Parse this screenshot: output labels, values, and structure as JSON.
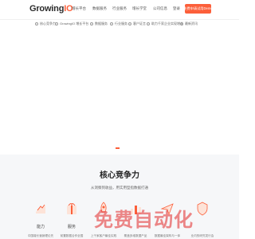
{
  "header": {
    "logo_text": "Growing",
    "logo_mark": "IO",
    "nav": [
      "增长平台",
      "数据服务",
      "行业服务",
      "增长学堂",
      "公司信息"
    ],
    "login": "登录",
    "trial_button": "免费申请试用Demo"
  },
  "subnav": {
    "items": [
      "核心竞争力",
      "GrowingIO 增长平台",
      "数据服务",
      "行业服务",
      "客户证言",
      "助力千家企业实现增长",
      "最新资讯"
    ]
  },
  "section": {
    "title": "核心竞争力",
    "subtitle": "从洞察到收益，用实用型指数据打通",
    "features": [
      {
        "label": "能力",
        "desc": "中国增长营销理论先",
        "icon": "hand-icon"
      },
      {
        "label": "服务",
        "desc": "前置数据合作全国",
        "icon": "gift-icon"
      },
      {
        "label": "",
        "desc": "上千家客户最佳实践",
        "icon": "rocket-icon"
      },
      {
        "label": "",
        "desc": "覆盖多维数据产品",
        "icon": "chart-icon"
      },
      {
        "label": "",
        "desc": "数据最佳架构与一体",
        "icon": "plane-icon"
      },
      {
        "label": "",
        "desc": "业内的研究发行会",
        "icon": "shield-icon"
      }
    ]
  },
  "watermark": "免费自动化",
  "colors": {
    "accent": "#fc5f3a",
    "section_bg": "#f6f7f9"
  }
}
